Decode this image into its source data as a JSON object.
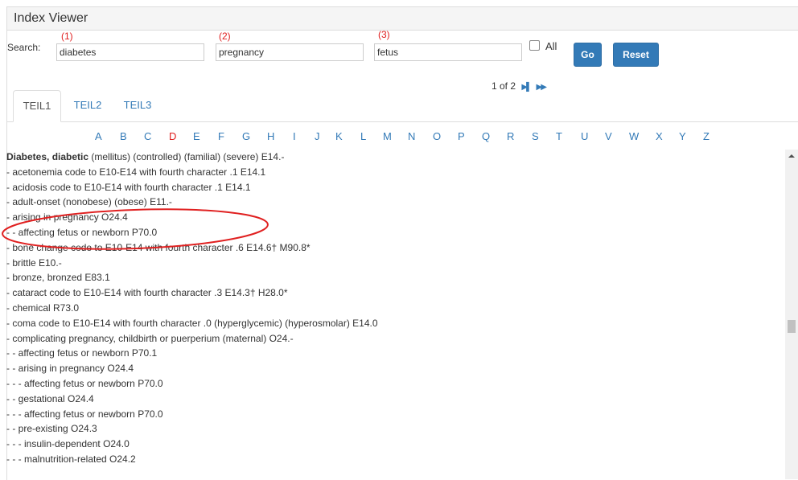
{
  "panel": {
    "title": "Index Viewer"
  },
  "annotations": [
    "(1)",
    "(2)",
    "(3)"
  ],
  "search": {
    "label": "Search:",
    "field1": "diabetes",
    "field2": "pregnancy",
    "field3": "fetus",
    "all_label": "All",
    "all_checked": false,
    "go_label": "Go",
    "reset_label": "Reset"
  },
  "pager": {
    "text": "1 of 2",
    "next_icon": "▶▌",
    "last_icon": "▶▶"
  },
  "tabs": [
    "TEIL1",
    "TEIL2",
    "TEIL3"
  ],
  "active_tab": "TEIL1",
  "letters": [
    "A",
    "B",
    "C",
    "D",
    "E",
    "F",
    "G",
    "H",
    "I",
    "J",
    "K",
    "L",
    "M",
    "N",
    "O",
    "P",
    "Q",
    "R",
    "S",
    "T",
    "U",
    "V",
    "W",
    "X",
    "Y",
    "Z"
  ],
  "current_letter": "D",
  "entries": [
    {
      "bold": "Diabetes, diabetic",
      "text": " (mellitus) (controlled) (familial) (severe) E14.-"
    },
    {
      "bold": "",
      "text": "- acetonemia code to E10-E14 with fourth character .1 E14.1"
    },
    {
      "bold": "",
      "text": "- acidosis code to E10-E14 with fourth character .1 E14.1"
    },
    {
      "bold": "",
      "text": "- adult-onset (nonobese) (obese) E11.-"
    },
    {
      "bold": "",
      "text": "- arising in pregnancy O24.4"
    },
    {
      "bold": "",
      "text": "- - affecting fetus or newborn P70.0"
    },
    {
      "bold": "",
      "text": "- bone change code to E10-E14 with fourth character .6 E14.6† M90.8*"
    },
    {
      "bold": "",
      "text": "- brittle E10.-"
    },
    {
      "bold": "",
      "text": "- bronze, bronzed E83.1"
    },
    {
      "bold": "",
      "text": "- cataract code to E10-E14 with fourth character .3 E14.3† H28.0*"
    },
    {
      "bold": "",
      "text": "- chemical R73.0"
    },
    {
      "bold": "",
      "text": "- coma code to E10-E14 with fourth character .0 (hyperglycemic) (hyperosmolar) E14.0"
    },
    {
      "bold": "",
      "text": "- complicating pregnancy, childbirth or puerperium (maternal) O24.-"
    },
    {
      "bold": "",
      "text": "- - affecting fetus or newborn P70.1"
    },
    {
      "bold": "",
      "text": "- - arising in pregnancy O24.4"
    },
    {
      "bold": "",
      "text": "- - - affecting fetus or newborn P70.0"
    },
    {
      "bold": "",
      "text": "- - gestational O24.4"
    },
    {
      "bold": "",
      "text": "- - - affecting fetus or newborn P70.0"
    },
    {
      "bold": "",
      "text": "- - pre-existing O24.3"
    },
    {
      "bold": "",
      "text": "- - - insulin-dependent O24.0"
    },
    {
      "bold": "",
      "text": "- - - malnutrition-related O24.2"
    }
  ],
  "colors": {
    "accent": "#337ab7",
    "annotation": "#e02020",
    "current_letter": "#e02020"
  }
}
